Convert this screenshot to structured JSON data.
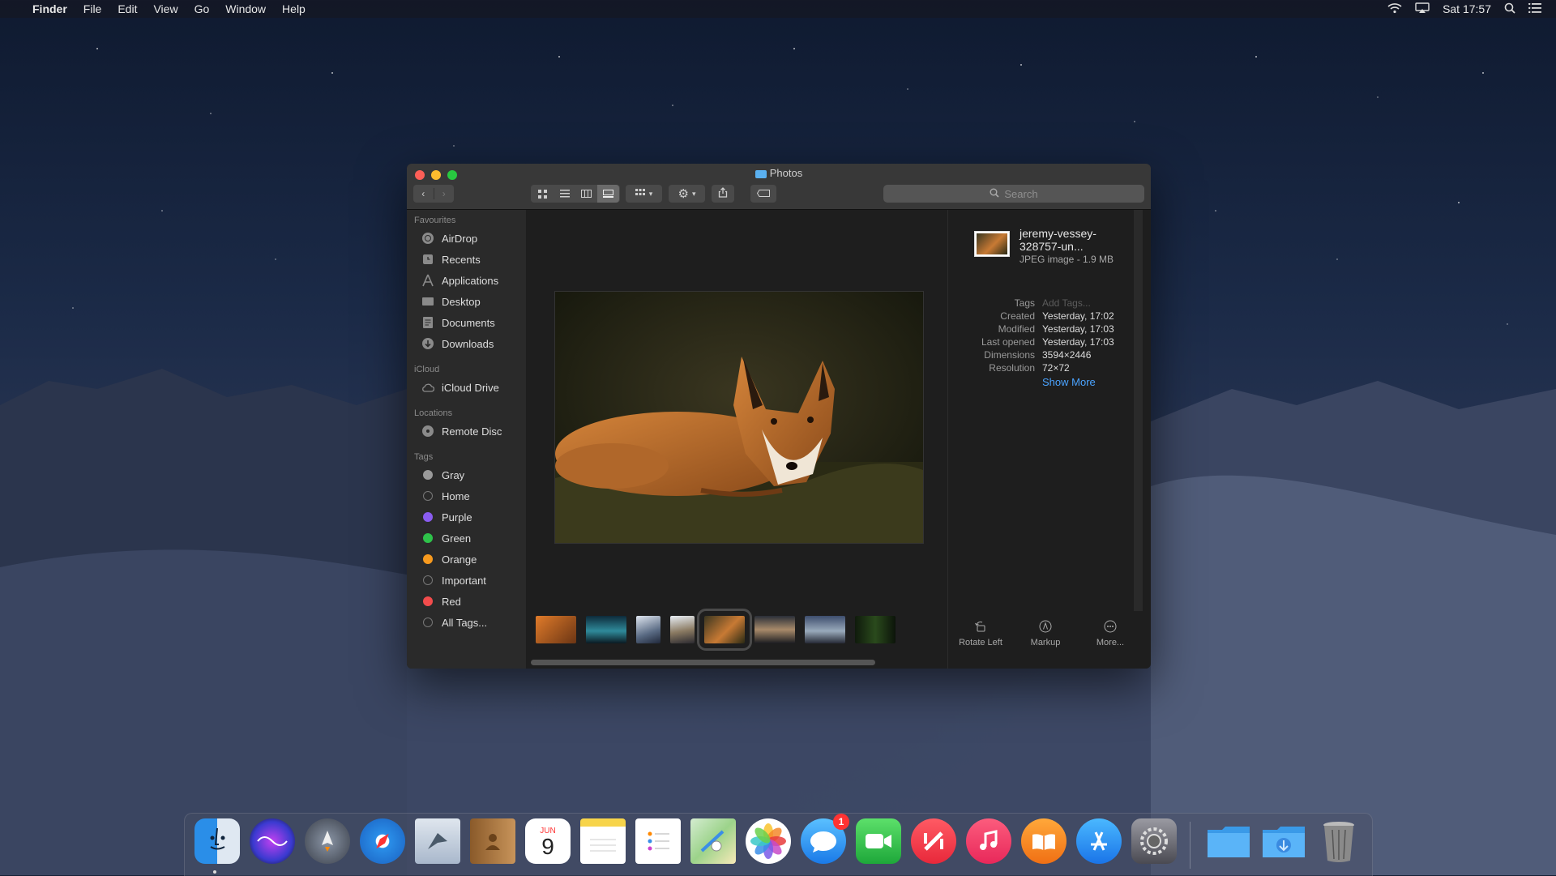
{
  "menubar": {
    "app": "Finder",
    "menus": [
      "File",
      "Edit",
      "View",
      "Go",
      "Window",
      "Help"
    ],
    "clock": "Sat 17:57"
  },
  "window": {
    "title": "Photos",
    "search_placeholder": "Search"
  },
  "sidebar": {
    "sections": {
      "favourites": "Favourites",
      "icloud": "iCloud",
      "locations": "Locations",
      "tags": "Tags"
    },
    "favourites": [
      {
        "label": "AirDrop",
        "icon": "airdrop-icon"
      },
      {
        "label": "Recents",
        "icon": "recents-icon"
      },
      {
        "label": "Applications",
        "icon": "applications-icon"
      },
      {
        "label": "Desktop",
        "icon": "desktop-icon"
      },
      {
        "label": "Documents",
        "icon": "documents-icon"
      },
      {
        "label": "Downloads",
        "icon": "downloads-icon"
      }
    ],
    "icloud": [
      {
        "label": "iCloud Drive",
        "icon": "cloud-icon"
      }
    ],
    "locations": [
      {
        "label": "Remote Disc",
        "icon": "disc-icon"
      }
    ],
    "tags": [
      {
        "label": "Gray",
        "color": "#9a9a9a"
      },
      {
        "label": "Home",
        "color": "none"
      },
      {
        "label": "Purple",
        "color": "#8a5cf0"
      },
      {
        "label": "Green",
        "color": "#2ec24a"
      },
      {
        "label": "Orange",
        "color": "#f79a1e"
      },
      {
        "label": "Important",
        "color": "none"
      },
      {
        "label": "Red",
        "color": "#f24c4c"
      },
      {
        "label": "All Tags...",
        "color": "none"
      }
    ]
  },
  "info": {
    "filename": "jeremy-vessey-328757-un...",
    "kind": "JPEG image - 1.9 MB",
    "rows": [
      {
        "key": "Tags",
        "value": "Add Tags..."
      },
      {
        "key": "Created",
        "value": "Yesterday, 17:02"
      },
      {
        "key": "Modified",
        "value": "Yesterday, 17:03"
      },
      {
        "key": "Last opened",
        "value": "Yesterday, 17:03"
      },
      {
        "key": "Dimensions",
        "value": "3594×2446"
      },
      {
        "key": "Resolution",
        "value": "72×72"
      }
    ],
    "show_more": "Show More",
    "actions": [
      {
        "label": "Rotate Left",
        "icon": "rotate-left-icon"
      },
      {
        "label": "Markup",
        "icon": "markup-icon"
      },
      {
        "label": "More...",
        "icon": "more-icon"
      }
    ]
  },
  "dock": {
    "calendar_month": "JUN",
    "calendar_day": "9",
    "messages_badge": "1",
    "apps": [
      "Finder",
      "Siri",
      "Launchpad",
      "Safari",
      "Mail",
      "Contacts",
      "Calendar",
      "Notes",
      "Reminders",
      "Maps",
      "Photos",
      "Messages",
      "FaceTime",
      "News",
      "iTunes",
      "iBooks",
      "App Store",
      "System Preferences",
      "Documents folder",
      "Downloads folder",
      "Trash"
    ]
  },
  "colors": {
    "accent_link": "#4aa3ff",
    "close": "#fe5f57",
    "minimize": "#febc2e",
    "zoom": "#28c840"
  }
}
